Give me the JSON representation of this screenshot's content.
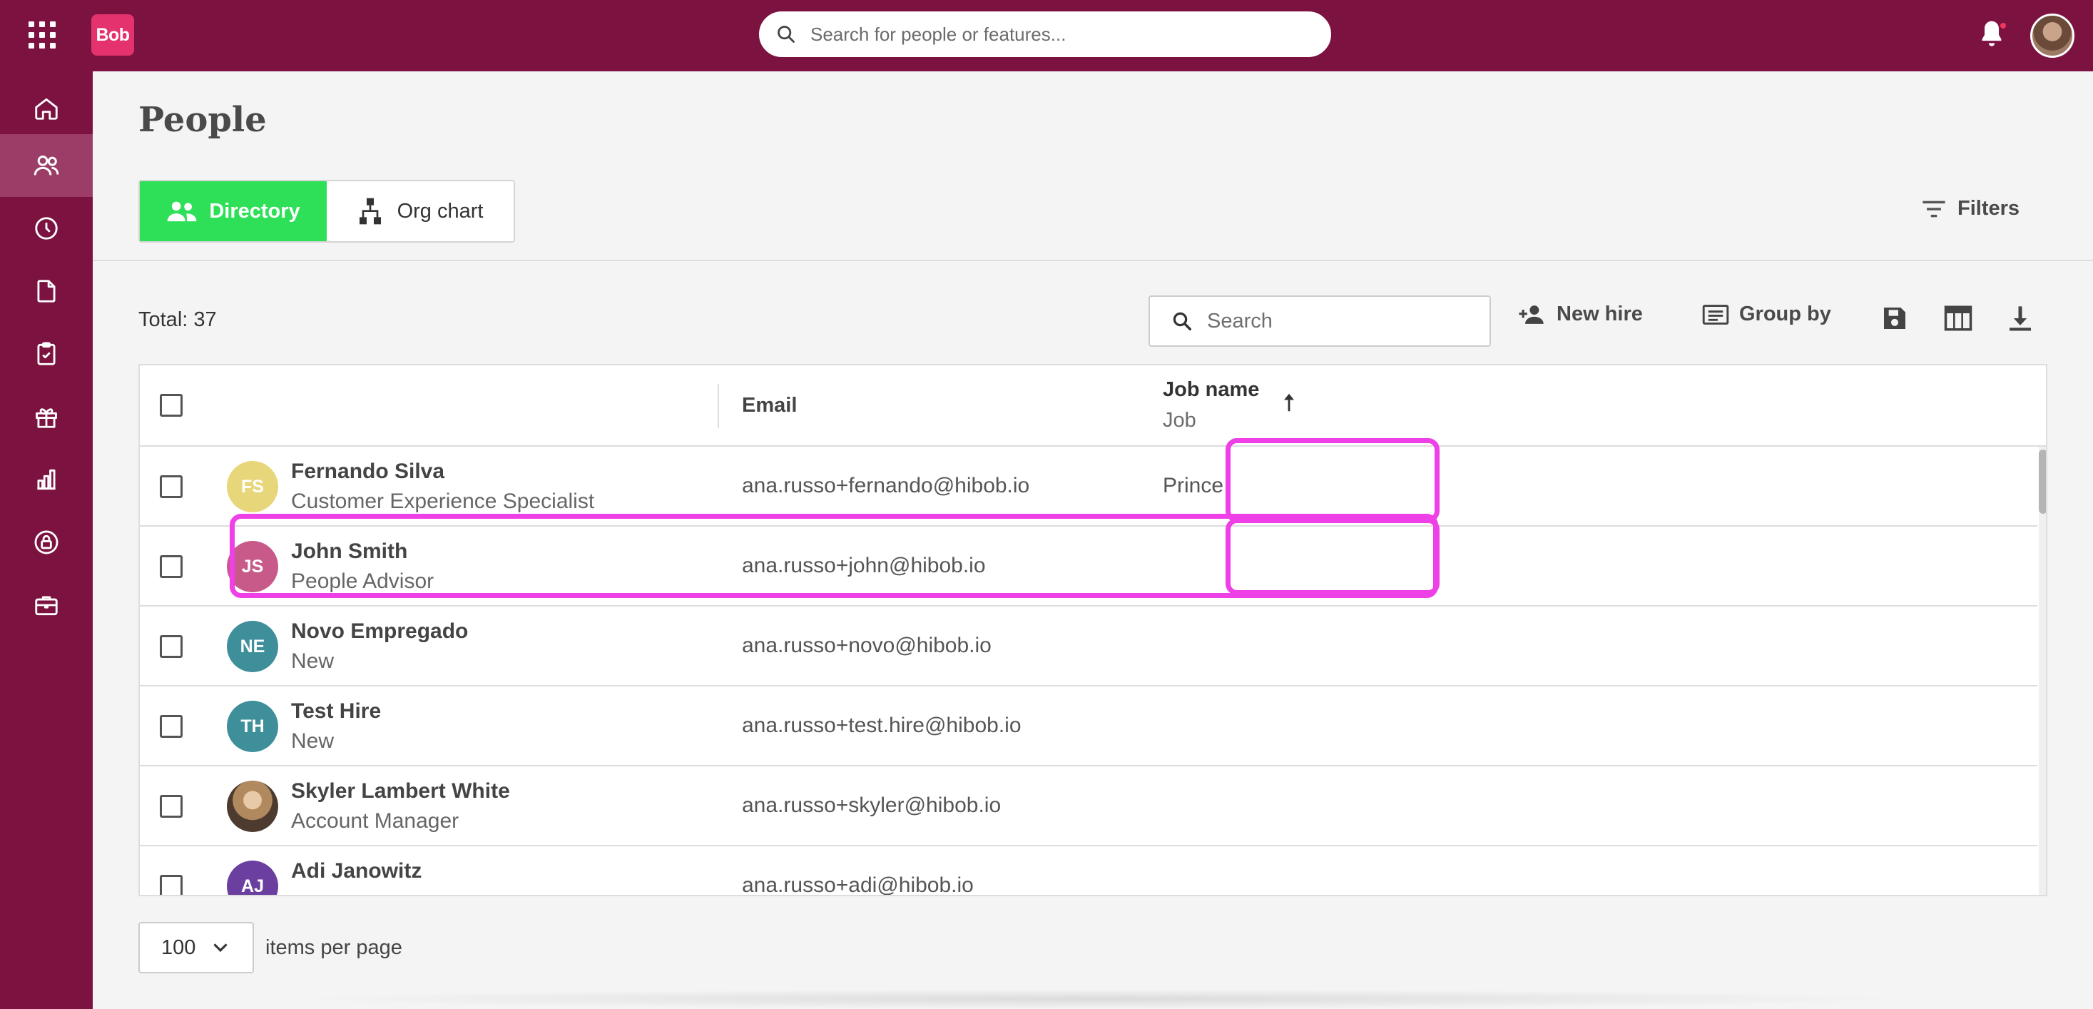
{
  "topbar": {
    "logo": "Bob",
    "search_placeholder": "Search for people or features..."
  },
  "sidebar": {
    "items": [
      {
        "icon": "home-icon"
      },
      {
        "icon": "people-icon",
        "active": true
      },
      {
        "icon": "clock-icon"
      },
      {
        "icon": "document-icon"
      },
      {
        "icon": "clipboard-icon"
      },
      {
        "icon": "gift-icon"
      },
      {
        "icon": "analytics-icon"
      },
      {
        "icon": "lock-icon"
      },
      {
        "icon": "briefcase-icon"
      }
    ],
    "help_icon": "help-icon"
  },
  "page": {
    "title": "People",
    "view_directory": "Directory",
    "view_org_chart": "Org chart",
    "filters": "Filters"
  },
  "toolbar": {
    "total": "Total: 37",
    "search_placeholder": "Search",
    "new_hire": "New hire",
    "group_by": "Group by"
  },
  "table": {
    "headers": {
      "email": "Email",
      "job_name": "Job name",
      "job_sub": "Job"
    },
    "rows": [
      {
        "initials": "FS",
        "name": "Fernando Silva",
        "title": "Customer Experience Specialist",
        "email": "ana.russo+fernando@hibob.io",
        "job": "Prince",
        "color": "#e8d67a"
      },
      {
        "initials": "JS",
        "name": "John Smith",
        "title": "People Advisor",
        "email": "ana.russo+john@hibob.io",
        "job": "",
        "color": "#c85a8a"
      },
      {
        "initials": "NE",
        "name": "Novo Empregado",
        "title": "New",
        "email": "ana.russo+novo@hibob.io",
        "job": "",
        "color": "#3f8f9b"
      },
      {
        "initials": "TH",
        "name": "Test Hire",
        "title": "New",
        "email": "ana.russo+test.hire@hibob.io",
        "job": "",
        "color": "#3f8f9b"
      },
      {
        "initials": "",
        "name": "Skyler Lambert White",
        "title": "Account Manager",
        "email": "ana.russo+skyler@hibob.io",
        "job": "",
        "color": "#5a4a40"
      },
      {
        "initials": "AJ",
        "name": "Adi Janowitz",
        "title": "",
        "email": "ana.russo+adi@hibob.io",
        "job": "",
        "color": "#6b3fa0"
      }
    ]
  },
  "pagination": {
    "per_page": "100",
    "label": "items per page"
  },
  "colors": {
    "brand": "#7c1240",
    "accent_green": "#2de057",
    "highlight": "#ef3fe6"
  }
}
